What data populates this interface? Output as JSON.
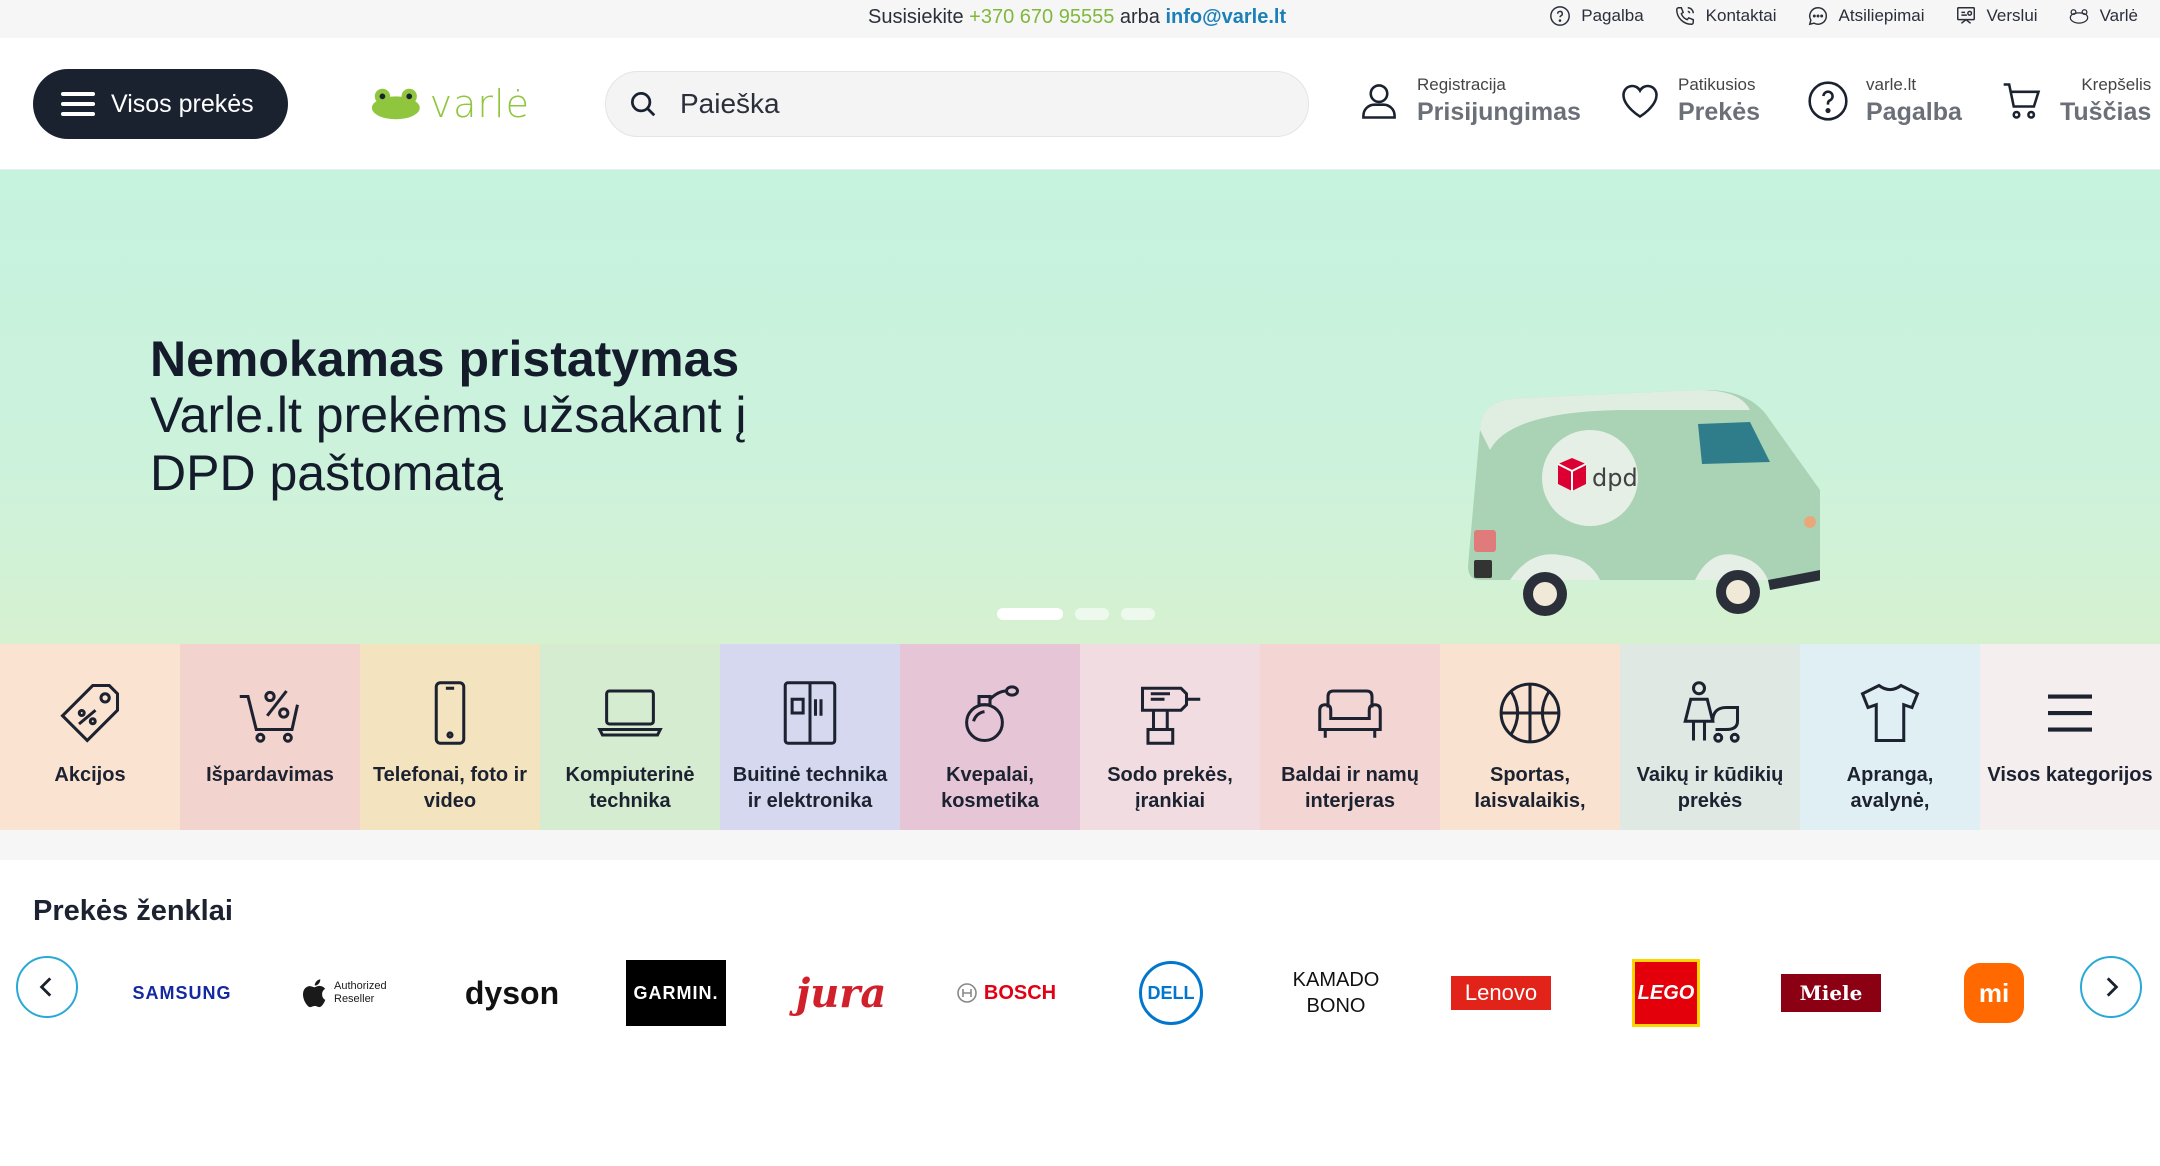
{
  "topbar": {
    "contact_prefix": "Susisiekite",
    "phone": "+370 670 95555",
    "or": "arba",
    "email": "info@varle.lt",
    "links": [
      {
        "label": "Pagalba",
        "icon": "help-icon"
      },
      {
        "label": "Kontaktai",
        "icon": "phone-icon"
      },
      {
        "label": "Atsiliepimai",
        "icon": "chat-icon"
      },
      {
        "label": "Verslui",
        "icon": "business-icon"
      },
      {
        "label": "Varlė",
        "icon": "frog-icon"
      }
    ]
  },
  "header": {
    "menu_label": "Visos prekės",
    "logo_text": "varlė",
    "search_placeholder": "Paieška",
    "account": {
      "small": "Registracija",
      "big": "Prisijungimas"
    },
    "favorites": {
      "small": "Patikusios",
      "big": "Prekės"
    },
    "help": {
      "small": "varle.lt",
      "big": "Pagalba"
    },
    "cart": {
      "small": "Krepšelis",
      "big": "Tuščias"
    }
  },
  "banner": {
    "title": "Nemokamas pristatymas",
    "subtitle": "Varle.lt prekėms užsakant į DPD paštomatą",
    "van_logo": "dpd",
    "slides": 3,
    "active_slide": 1
  },
  "categories": [
    {
      "label": "Akcijos",
      "icon": "tag-icon",
      "color": "#fbe3d2"
    },
    {
      "label": "Išpardavimas",
      "icon": "sale-cart-icon",
      "color": "#f3d3cd"
    },
    {
      "label": "Telefonai, foto ir video",
      "icon": "phone-device-icon",
      "color": "#f3e3bf"
    },
    {
      "label": "Kompiuterinė technika",
      "icon": "laptop-icon",
      "color": "#d5ecd1"
    },
    {
      "label": "Buitinė technika ir elektronika",
      "icon": "fridge-icon",
      "color": "#d5d8ef"
    },
    {
      "label": "Kvepalai, kosmetika",
      "icon": "perfume-icon",
      "color": "#e5c5d6"
    },
    {
      "label": "Sodo prekės, įrankiai",
      "icon": "drill-icon",
      "color": "#f1dde1"
    },
    {
      "label": "Baldai ir namų interjeras",
      "icon": "sofa-icon",
      "color": "#f3d6d3"
    },
    {
      "label": "Sportas, laisvalaikis,",
      "icon": "basketball-icon",
      "color": "#fae2d1"
    },
    {
      "label": "Vaikų ir kūdikių prekės",
      "icon": "child-stroller-icon",
      "color": "#dfe8e2"
    },
    {
      "label": "Apranga, avalynė,",
      "icon": "tshirt-icon",
      "color": "#e0eff3"
    },
    {
      "label": "Visos kategorijos",
      "icon": "menu-icon",
      "color": "#f4eeee"
    }
  ],
  "brands": {
    "title": "Prekės ženklai",
    "items": [
      "SAMSUNG",
      "Authorized Reseller",
      "dyson",
      "GARMIN.",
      "jura",
      "BOSCH",
      "DELL",
      "KAMADO BONO",
      "Lenovo",
      "LEGO",
      "Miele",
      "mi"
    ]
  }
}
